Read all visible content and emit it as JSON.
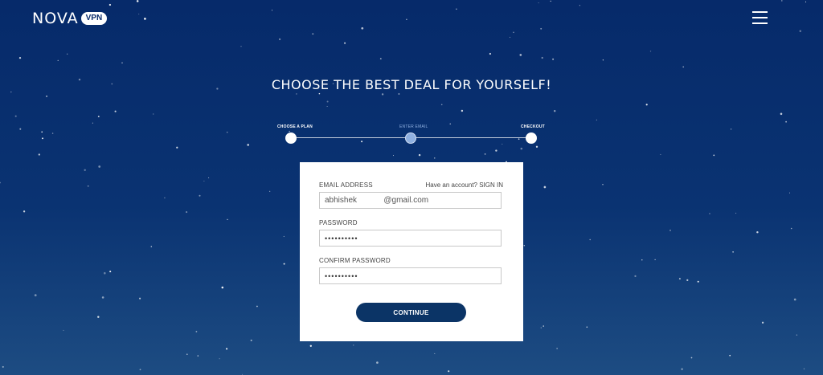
{
  "brand": {
    "name": "NOVA",
    "badge": "VPN"
  },
  "header": {
    "menu_icon": "hamburger-menu-icon"
  },
  "headline": "CHOOSE THE BEST DEAL FOR YOURSELF!",
  "stepper": {
    "steps": [
      {
        "label": "CHOOSE A PLAN",
        "state": "done"
      },
      {
        "label": "ENTER EMAIL",
        "state": "active"
      },
      {
        "label": "CHECKOUT",
        "state": "pending"
      }
    ]
  },
  "form": {
    "email_label": "EMAIL ADDRESS",
    "signin_text": "Have an account? SIGN IN",
    "email_value": "abhishek            @gmail.com",
    "password_label": "PASSWORD",
    "password_value": "••••••••••",
    "confirm_label": "CONFIRM PASSWORD",
    "confirm_value": "••••••••••",
    "continue_label": "CONTINUE"
  },
  "colors": {
    "background_top": "#062a6a",
    "background_bottom": "#1d4c82",
    "button": "#0b3466",
    "active_step": "#8fb0e0"
  }
}
